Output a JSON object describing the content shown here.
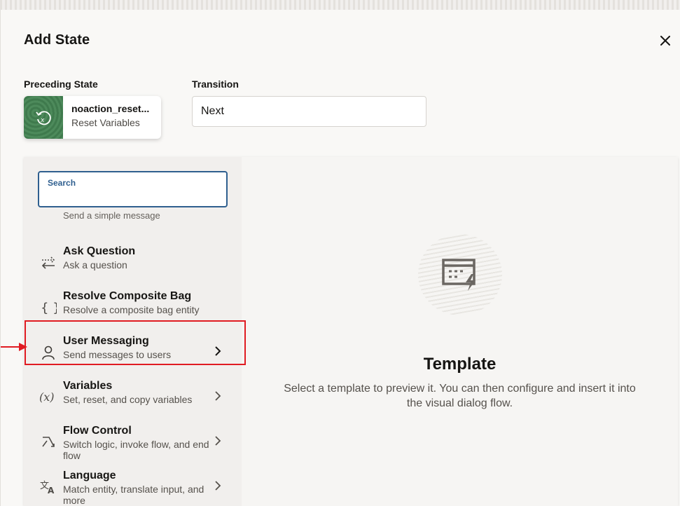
{
  "dialog": {
    "title": "Add State",
    "close_icon": "close-icon"
  },
  "preceding_state": {
    "label": "Preceding State",
    "name": "noaction_reset...",
    "type": "Reset Variables",
    "icon": "reset-variables-icon"
  },
  "transition": {
    "label": "Transition",
    "value": "Next"
  },
  "search": {
    "label": "Search",
    "value": ""
  },
  "state_list": {
    "clipped_item_desc": "Send a simple message",
    "items": [
      {
        "title": "Ask Question",
        "desc": "Ask a question",
        "icon": "swap-arrows-icon",
        "has_children": false
      },
      {
        "title": "Resolve Composite Bag",
        "desc": "Resolve a composite bag entity",
        "icon": "braces-icon",
        "has_children": false
      },
      {
        "title": "User Messaging",
        "desc": "Send messages to users",
        "icon": "user-icon",
        "has_children": true,
        "highlighted": true
      },
      {
        "title": "Variables",
        "desc": "Set, reset, and copy variables",
        "icon": "variable-x-icon",
        "has_children": true
      },
      {
        "title": "Flow Control",
        "desc": "Switch logic, invoke flow, and end flow",
        "icon": "flow-control-icon",
        "has_children": true
      },
      {
        "title": "Language",
        "desc": "Match entity, translate input, and more",
        "icon": "translate-icon",
        "has_children": true
      }
    ]
  },
  "template_preview": {
    "icon": "template-icon",
    "title": "Template",
    "desc": "Select a template to preview it. You can then configure and insert it into the visual dialog flow."
  },
  "colors": {
    "highlight": "#e01b22",
    "search_border": "#2f5f8f",
    "card_thumb": "#4d8a5b"
  }
}
